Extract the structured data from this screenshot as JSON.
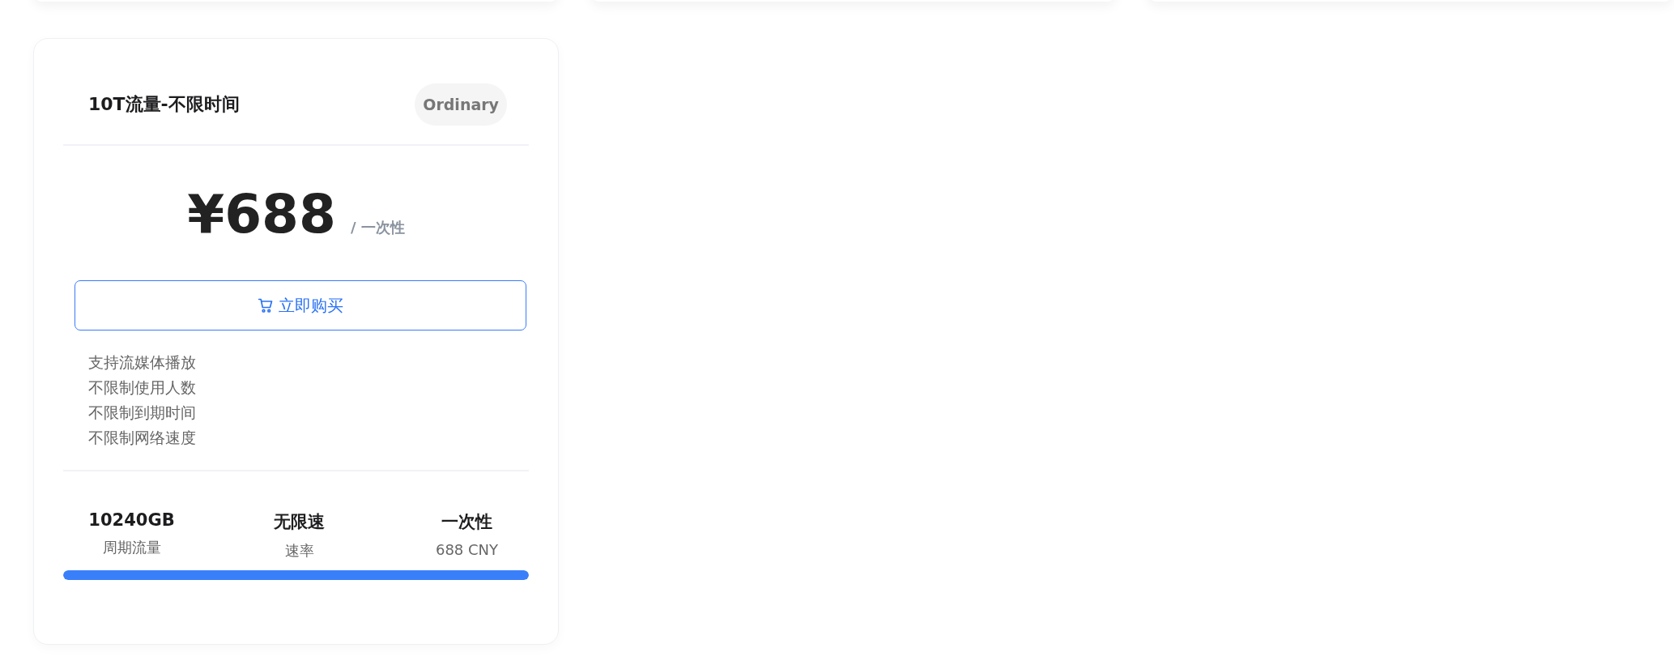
{
  "plan": {
    "title": "10T流量-不限时间",
    "badge": "Ordinary",
    "price": "¥688",
    "period": "/ 一次性",
    "buy_button": "立即购买",
    "features": [
      "支持流媒体播放",
      "不限制使用人数",
      "不限制到期时间",
      "不限制网络速度"
    ],
    "stats": [
      {
        "value": "10240GB",
        "label": "周期流量"
      },
      {
        "value": "无限速",
        "label": "速率"
      },
      {
        "value": "一次性",
        "label": "688 CNY"
      }
    ],
    "progress": {
      "level": 1
    }
  }
}
